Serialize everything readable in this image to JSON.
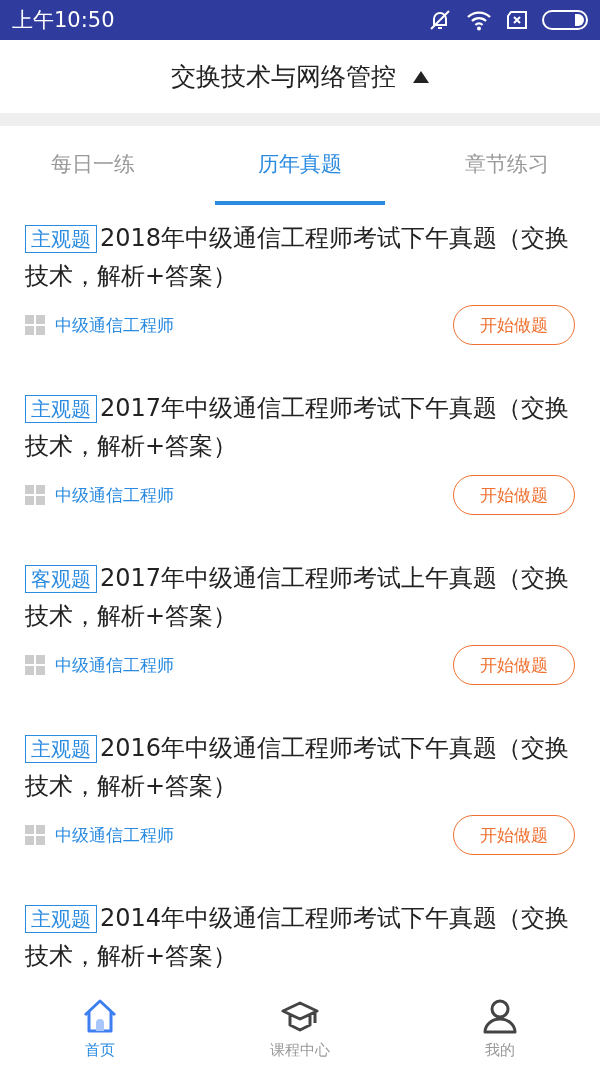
{
  "status_bar": {
    "time": "上午10:50"
  },
  "header": {
    "title": "交换技术与网络管控",
    "expanded": true
  },
  "tabs": [
    {
      "label": "每日一练",
      "selected": false
    },
    {
      "label": "历年真题",
      "selected": true
    },
    {
      "label": "章节练习",
      "selected": false
    }
  ],
  "papers": [
    {
      "tag": "主观题",
      "title": "2018年中级通信工程师考试下午真题（交换技术，解析+答案）",
      "category": "中级通信工程师",
      "button": "开始做题"
    },
    {
      "tag": "主观题",
      "title": "2017年中级通信工程师考试下午真题（交换技术，解析+答案）",
      "category": "中级通信工程师",
      "button": "开始做题"
    },
    {
      "tag": "客观题",
      "title": "2017年中级通信工程师考试上午真题（交换技术，解析+答案）",
      "category": "中级通信工程师",
      "button": "开始做题"
    },
    {
      "tag": "主观题",
      "title": "2016年中级通信工程师考试下午真题（交换技术，解析+答案）",
      "category": "中级通信工程师",
      "button": "开始做题"
    },
    {
      "tag": "主观题",
      "title": "2014年中级通信工程师考试下午真题（交换技术，解析+答案）"
    }
  ],
  "bottom_nav": [
    {
      "label": "首页",
      "selected": true,
      "kind": "home"
    },
    {
      "label": "课程中心",
      "selected": false,
      "kind": "course"
    },
    {
      "label": "我的",
      "selected": false,
      "kind": "profile"
    }
  ]
}
